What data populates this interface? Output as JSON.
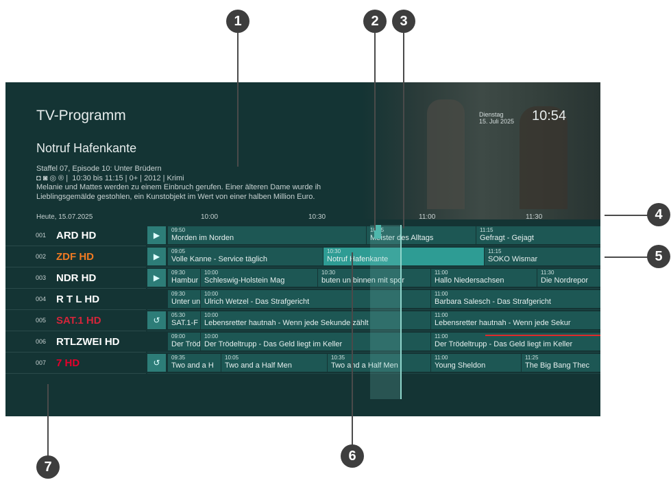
{
  "header": {
    "title": "TV-Programm",
    "date_weekday": "Dienstag",
    "date_day": "15. Juli 2025",
    "clock": "10:54"
  },
  "info": {
    "show_title": "Notruf Hafenkante",
    "episode": "Staffel 07, Episode 10: Unter Brüdern",
    "details": "10:30 bis 11:15  |  0+  |  2012  |  Krimi",
    "details_icons": "◘ ◙ ◎ ®",
    "description_line1": "Melanie und Mattes werden zu einem Einbruch gerufen. Einer älteren Dame wurde ih",
    "description_line2": "Lieblingsgemälde gestohlen, ein Kunstobjekt im Wert von einer halben Million Euro."
  },
  "timebar": {
    "date": "Heute, 15.07.2025",
    "times": [
      "10:00",
      "10:30",
      "11:00",
      "11:30"
    ]
  },
  "channels": [
    {
      "num": "001",
      "logo": "ARD HD",
      "color": "#ffffff"
    },
    {
      "num": "002",
      "logo": "ZDF HD",
      "color": "#f07a22"
    },
    {
      "num": "003",
      "logo": "NDR HD",
      "color": "#ffffff"
    },
    {
      "num": "004",
      "logo": "R T L HD",
      "color": "#ffffff"
    },
    {
      "num": "005",
      "logo": "SAT.1 HD",
      "color": "#d3253a"
    },
    {
      "num": "006",
      "logo": "RTLZWEI HD",
      "color": "#ffffff"
    },
    {
      "num": "007",
      "logo": "7 HD",
      "color": "#e4002b"
    }
  ],
  "rows": [
    {
      "ctl": "▶",
      "cells": [
        {
          "t": "09:50",
          "n": "Morden im Norden"
        },
        {
          "t": "10:45",
          "n": "Meister des Alltags"
        },
        {
          "t": "11:15",
          "n": "Gefragt - Gejagt"
        }
      ]
    },
    {
      "ctl": "▶",
      "cells": [
        {
          "t": "09:05",
          "n": "Volle Kanne - Service täglich"
        },
        {
          "t": "10:30",
          "n": "Notruf Hafenkante"
        },
        {
          "t": "11:15",
          "n": "SOKO Wismar"
        }
      ]
    },
    {
      "ctl": "▶",
      "cells": [
        {
          "t": "09:30",
          "n": "Hambur"
        },
        {
          "t": "10:00",
          "n": "Schleswig-Holstein Mag"
        },
        {
          "t": "10:30",
          "n": "buten un binnen mit spor"
        },
        {
          "t": "11:00",
          "n": "Hallo Niedersachsen"
        },
        {
          "t": "11:30",
          "n": "Die Nordrepor"
        }
      ]
    },
    {
      "ctl": "",
      "cells": [
        {
          "t": "09:30",
          "n": "Unter un"
        },
        {
          "t": "10:00",
          "n": "Ulrich Wetzel - Das Strafgericht"
        },
        {
          "t": "11:00",
          "n": "Barbara Salesch - Das Strafgericht"
        }
      ]
    },
    {
      "ctl": "↺",
      "cells": [
        {
          "t": "05:30",
          "n": "SAT.1-F"
        },
        {
          "t": "10:00",
          "n": "Lebensretter hautnah - Wenn jede Sekunde zählt"
        },
        {
          "t": "11:00",
          "n": "Lebensretter hautnah - Wenn jede Sekur"
        }
      ]
    },
    {
      "ctl": "",
      "cells": [
        {
          "t": "09:00",
          "n": "Der Tröd"
        },
        {
          "t": "10:00",
          "n": "Der Trödeltrupp - Das Geld liegt im Keller"
        },
        {
          "t": "11:00",
          "n": "Der Trödeltrupp - Das Geld liegt im Keller"
        }
      ]
    },
    {
      "ctl": "↺",
      "cells": [
        {
          "t": "09:35",
          "n": "Two and a H"
        },
        {
          "t": "10:05",
          "n": "Two and a Half Men"
        },
        {
          "t": "10:35",
          "n": "Two and a Half Men"
        },
        {
          "t": "11:00",
          "n": "Young Sheldon"
        },
        {
          "t": "11:25",
          "n": "The Big Bang Thec"
        }
      ]
    }
  ],
  "callouts": [
    "1",
    "2",
    "3",
    "4",
    "5",
    "6",
    "7"
  ]
}
